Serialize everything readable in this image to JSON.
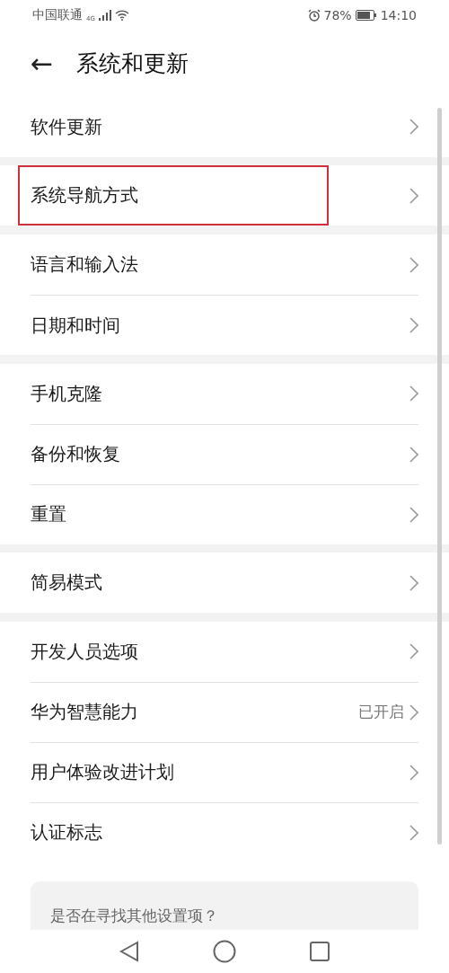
{
  "status_bar": {
    "carrier": "中国联通",
    "network": "4G",
    "battery": "78%",
    "time": "14:10"
  },
  "header": {
    "back": "←",
    "title": "系统和更新"
  },
  "groups": [
    {
      "items": [
        {
          "label": "软件更新",
          "highlighted": false
        }
      ]
    },
    {
      "items": [
        {
          "label": "系统导航方式",
          "highlighted": true
        }
      ]
    },
    {
      "items": [
        {
          "label": "语言和输入法",
          "highlighted": false
        },
        {
          "label": "日期和时间",
          "highlighted": false
        }
      ]
    },
    {
      "items": [
        {
          "label": "手机克隆",
          "highlighted": false
        },
        {
          "label": "备份和恢复",
          "highlighted": false
        },
        {
          "label": "重置",
          "highlighted": false
        }
      ]
    },
    {
      "items": [
        {
          "label": "简易模式",
          "highlighted": false
        }
      ]
    },
    {
      "items": [
        {
          "label": "开发人员选项",
          "highlighted": false
        },
        {
          "label": "华为智慧能力",
          "value": "已开启",
          "highlighted": false
        },
        {
          "label": "用户体验改进计划",
          "highlighted": false
        },
        {
          "label": "认证标志",
          "highlighted": false
        }
      ]
    }
  ],
  "suggestion_card": {
    "text": "是否在寻找其他设置项？"
  }
}
